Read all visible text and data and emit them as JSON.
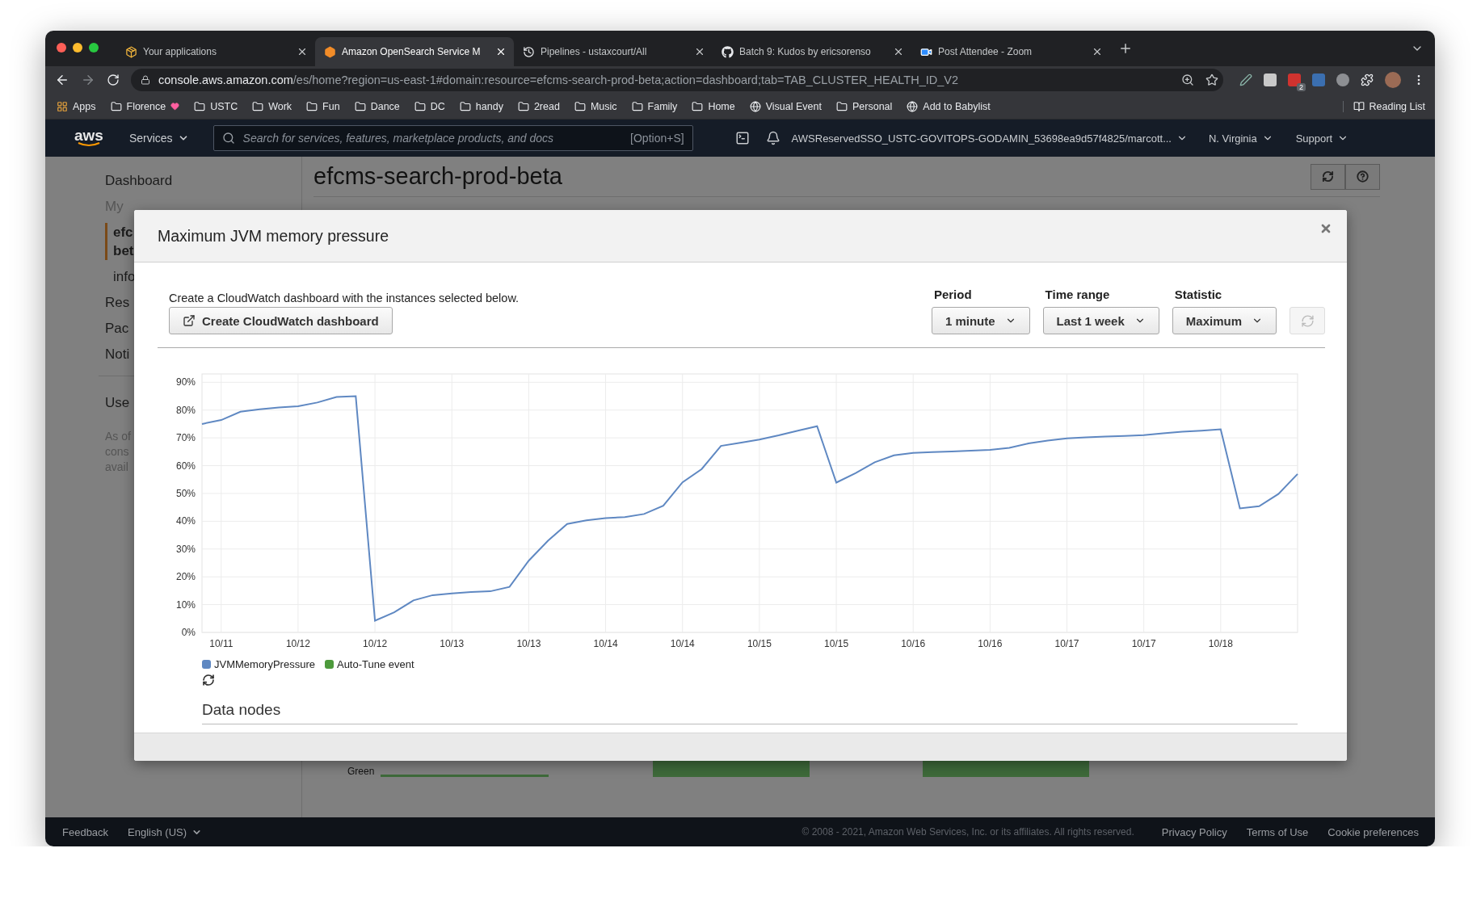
{
  "browser": {
    "tabs": [
      {
        "title": "Your applications",
        "kind": "box",
        "selected": false
      },
      {
        "title": "Amazon OpenSearch Service M",
        "kind": "hexagon",
        "selected": true
      },
      {
        "title": "Pipelines - ustaxcourt/All",
        "kind": "history",
        "selected": false
      },
      {
        "title": "Batch 9: Kudos by ericsorenso",
        "kind": "github",
        "selected": false
      },
      {
        "title": "Post Attendee - Zoom",
        "kind": "video",
        "selected": false
      }
    ],
    "url_host": "console.aws.amazon.com",
    "url_path": "/es/home?region=us-east-1#domain:resource=efcms-search-prod-beta;action=dashboard;tab=TAB_CLUSTER_HEALTH_ID_V2",
    "extension_badge": "2",
    "bookmarks": [
      {
        "label": "Apps",
        "kind": "apps",
        "heart": false
      },
      {
        "label": "Florence",
        "kind": "folder",
        "heart": true
      },
      {
        "label": "USTC",
        "kind": "folder",
        "heart": false
      },
      {
        "label": "Work",
        "kind": "folder",
        "heart": false
      },
      {
        "label": "Fun",
        "kind": "folder",
        "heart": false
      },
      {
        "label": "Dance",
        "kind": "folder",
        "heart": false
      },
      {
        "label": "DC",
        "kind": "folder",
        "heart": false
      },
      {
        "label": "handy",
        "kind": "folder",
        "heart": false
      },
      {
        "label": "2read",
        "kind": "folder",
        "heart": false
      },
      {
        "label": "Music",
        "kind": "folder",
        "heart": false
      },
      {
        "label": "Family",
        "kind": "folder",
        "heart": false
      },
      {
        "label": "Home",
        "kind": "folder",
        "heart": false
      },
      {
        "label": "Visual Event",
        "kind": "globe",
        "heart": false
      },
      {
        "label": "Personal",
        "kind": "folder",
        "heart": false
      },
      {
        "label": "Add to Babylist",
        "kind": "globe",
        "heart": false
      }
    ],
    "reading_list": "Reading List"
  },
  "aws_header": {
    "logo": "aws",
    "services": "Services",
    "search": {
      "placeholder": "Search for services, features, marketplace products, and docs",
      "shortcut": "[Option+S]"
    },
    "account": "AWSReservedSSO_USTC-GOVITOPS-GODAMIN_53698ea9d57f4825/marcott...",
    "region": "N. Virginia",
    "support": "Support"
  },
  "sidebar": {
    "dashboard": "Dashboard",
    "heading": "My",
    "domains": [
      {
        "lines": [
          "efc",
          "bet"
        ],
        "selected": true
      }
    ],
    "domain_sub": "info",
    "links": [
      "Res",
      "Pac",
      "Noti"
    ],
    "section_link": "Use",
    "note_lines": [
      "As of",
      "cons",
      "avail"
    ]
  },
  "main": {
    "title": "efcms-search-prod-beta",
    "status_label": "Green"
  },
  "modal": {
    "title": "Maximum JVM memory pressure",
    "description": "Create a CloudWatch dashboard with the instances selected below.",
    "create_button": "Create CloudWatch dashboard",
    "selectors": [
      {
        "label": "Period",
        "value": "1 minute"
      },
      {
        "label": "Time range",
        "value": "Last 1 week"
      },
      {
        "label": "Statistic",
        "value": "Maximum"
      }
    ],
    "chart_data": {
      "type": "line",
      "grid": true,
      "categories": [
        null,
        "10/11",
        null,
        null,
        null,
        "10/12",
        null,
        null,
        null,
        "10/12",
        null,
        null,
        null,
        "10/13",
        null,
        null,
        null,
        "10/13",
        null,
        null,
        null,
        "10/14",
        null,
        null,
        null,
        "10/14",
        null,
        null,
        null,
        "10/15",
        null,
        null,
        null,
        "10/15",
        null,
        null,
        null,
        "10/16",
        null,
        null,
        null,
        "10/16",
        null,
        null,
        null,
        "10/17",
        null,
        null,
        null,
        "10/17",
        null,
        null,
        null,
        "10/18",
        null,
        null,
        null,
        null
      ],
      "series": [
        {
          "name": "JVMMemoryPressure",
          "color": "#5f88c2",
          "values": [
            75,
            76.4,
            79.4,
            80.3,
            80.9,
            81.4,
            82.7,
            84.7,
            85,
            4.2,
            7.2,
            11.5,
            13.4,
            14,
            14.5,
            14.8,
            16.4,
            25.8,
            33,
            39,
            40.3,
            41.1,
            41.5,
            42.6,
            45.6,
            54,
            58.8,
            67.1,
            68.2,
            69.4,
            70.9,
            72.6,
            74.2,
            53.9,
            57.3,
            61.2,
            63.7,
            64.6,
            64.9,
            65.1,
            65.4,
            65.7,
            66.4,
            68,
            69,
            69.8,
            70.2,
            70.5,
            70.7,
            71,
            71.6,
            72.2,
            72.6,
            73.1,
            44.6,
            45.4,
            49.8,
            57
          ]
        }
      ],
      "ylim": [
        0,
        93
      ],
      "yticks": [
        {
          "value": 0,
          "label": "0%"
        },
        {
          "value": 10,
          "label": "10%"
        },
        {
          "value": 20,
          "label": "20%"
        },
        {
          "value": 30,
          "label": "30%"
        },
        {
          "value": 40,
          "label": "40%"
        },
        {
          "value": 50,
          "label": "50%"
        },
        {
          "value": 60,
          "label": "60%"
        },
        {
          "value": 70,
          "label": "70%"
        },
        {
          "value": 80,
          "label": "80%"
        },
        {
          "value": 90,
          "label": "90%"
        }
      ]
    },
    "event_legend": {
      "name": "Auto-Tune event",
      "color": "#4d9a3c"
    },
    "section_title": "Data nodes"
  },
  "footer": {
    "feedback": "Feedback",
    "language": "English (US)",
    "copyright": "© 2008 - 2021, Amazon Web Services, Inc. or its affiliates. All rights reserved.",
    "links": [
      "Privacy Policy",
      "Terms of Use",
      "Cookie preferences"
    ]
  }
}
